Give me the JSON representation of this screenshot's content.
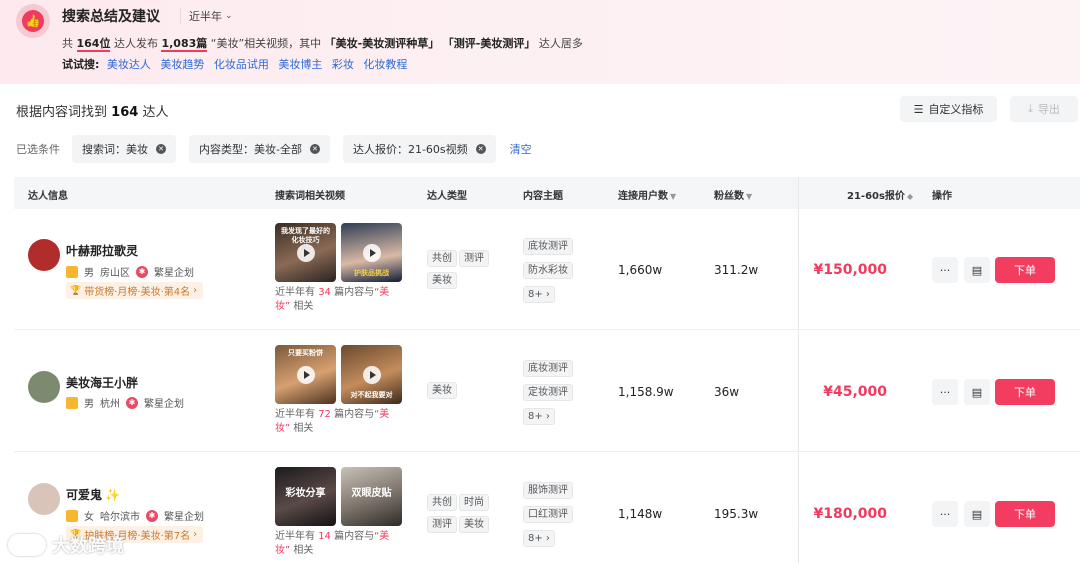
{
  "banner": {
    "title": "搜索总结及建议",
    "period": "近半年",
    "summary": {
      "p1": "共",
      "count": "164位",
      "p2": "达人发布",
      "videos": "1,083篇",
      "p3": "“美妆”相关视频，其中",
      "topic1": "「美妆-美妆测评种草」",
      "topic2": "「测评-美妆测评」",
      "p4": "达人居多"
    },
    "try_label": "试试搜:",
    "try_links": [
      "美妆达人",
      "美妆趋势",
      "化妆品试用",
      "美妆博主",
      "彩妆",
      "化妆教程"
    ]
  },
  "results": {
    "prefix": "根据内容词找到",
    "count": "164",
    "suffix": "达人",
    "custom_btn": "自定义指标",
    "export_btn": "导出"
  },
  "filters": {
    "label": "已选条件",
    "chips": [
      "搜索词：美妆",
      "内容类型：美妆-全部",
      "达人报价：21-60s视频"
    ],
    "clear": "清空"
  },
  "table": {
    "headers": [
      "达人信息",
      "搜索词相关视频",
      "达人类型",
      "内容主题",
      "连接用户数",
      "粉丝数",
      "21-60s报价",
      "操作"
    ],
    "order_label": "下单",
    "note_prefix": "近半年有",
    "note_mid": "篇内容与",
    "note_kw": "“美妆”",
    "note_suffix": "相关",
    "rows": [
      {
        "name": "叶赫那拉歌灵",
        "gender": "男",
        "city": "房山区",
        "agency": "繁星企划",
        "rank": "带货榜·月榜·美妆·第4名",
        "thumb1": "我发现了最好的化妆技巧",
        "thumb2": "护肤品挑战",
        "count": "34",
        "types": [
          "共创",
          "测评",
          "美妆"
        ],
        "topics": [
          "底妆测评",
          "防水彩妆",
          "8+"
        ],
        "users": "1,660w",
        "fans": "311.2w",
        "price": "¥150,000"
      },
      {
        "name": "美妆海王小胖",
        "gender": "男",
        "city": "杭州",
        "agency": "繁星企划",
        "rank": "",
        "thumb1": "只要买粉饼",
        "thumb2": "对不起我要对",
        "count": "72",
        "types": [
          "美妆"
        ],
        "topics": [
          "底妆测评",
          "定妆测评",
          "8+"
        ],
        "users": "1,158.9w",
        "fans": "36w",
        "price": "¥45,000"
      },
      {
        "name": "可爱鬼",
        "gender": "女",
        "city": "哈尔滨市",
        "agency": "繁星企划",
        "rank": "护肤榜·月榜·美妆·第7名",
        "thumb1": "彩妆分享",
        "thumb2": "双眼皮贴",
        "count": "14",
        "types": [
          "共创",
          "时尚",
          "测评",
          "美妆"
        ],
        "topics": [
          "服饰测评",
          "口红测评",
          "8+"
        ],
        "users": "1,148w",
        "fans": "195.3w",
        "price": "¥180,000"
      }
    ]
  },
  "watermark": "大数跨境",
  "colors": {
    "accent": "#f03b5e",
    "link": "#2d6ad6",
    "banner_bg": "#fde9ee"
  }
}
